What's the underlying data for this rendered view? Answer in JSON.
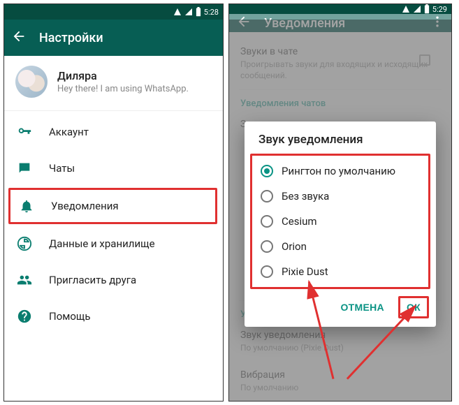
{
  "statusbar": {
    "time_left": "5:28",
    "time_right": "5:29"
  },
  "left": {
    "appbar_title": "Настройки",
    "profile": {
      "name": "Диляра",
      "status": "Hey there! I am using WhatsApp."
    },
    "menu": {
      "account": "Аккаунт",
      "chats": "Чаты",
      "notifications": "Уведомления",
      "data": "Данные и хранилище",
      "invite": "Пригласить друга",
      "help": "Помощь"
    }
  },
  "right": {
    "appbar_title": "Уведомления",
    "bg": {
      "chat_sounds_title": "Звуки в чате",
      "chat_sounds_sub": "Проигрывать звуки для входящих и исходящих сообщений.",
      "chats_group_label": "Уведомления чатов",
      "sound_title": "Звук уведомления",
      "groups_group_label": "Уведомления групп",
      "group_sound_title": "Звук уведомления",
      "group_sound_sub": "По умолчанию (Pixie Dust)",
      "vibration_title": "Вибрация",
      "vibration_sub": "По умолчанию"
    },
    "dialog": {
      "title": "Звук уведомления",
      "options": {
        "default": "Рингтон по умолчанию",
        "silent": "Без звука",
        "cesium": "Cesium",
        "orion": "Orion",
        "pixie": "Pixie Dust"
      },
      "cancel": "ОТМЕНА",
      "ok": "ОК"
    }
  }
}
